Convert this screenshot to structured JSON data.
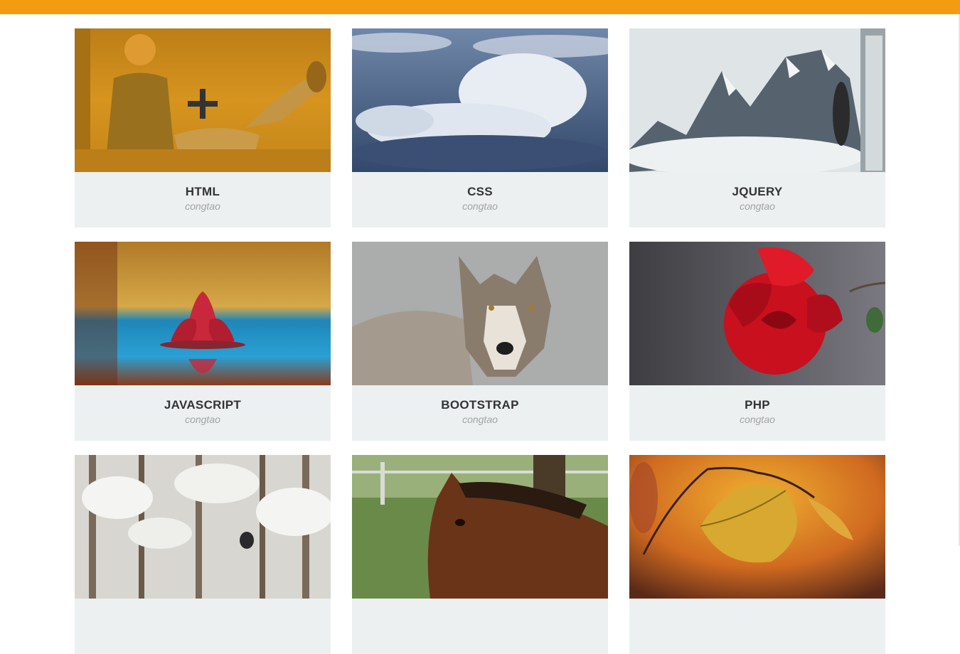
{
  "header": {
    "accent_color": "#f39c12"
  },
  "portfolio": {
    "hover_icon": "plus-icon",
    "items": [
      {
        "title": "HTML",
        "author": "congtao",
        "image": "couple-in-grass-photo",
        "hovered": true
      },
      {
        "title": "CSS",
        "author": "congtao",
        "image": "clouds-photo",
        "hovered": false
      },
      {
        "title": "JQUERY",
        "author": "congtao",
        "image": "mountains-photo",
        "hovered": false
      },
      {
        "title": "JAVASCRIPT",
        "author": "congtao",
        "image": "water-lily-photo",
        "hovered": false
      },
      {
        "title": "BOOTSTRAP",
        "author": "congtao",
        "image": "wolf-photo",
        "hovered": false
      },
      {
        "title": "PHP",
        "author": "congtao",
        "image": "red-rose-photo",
        "hovered": false
      },
      {
        "title": "",
        "author": "",
        "image": "snowy-forest-wolf-photo",
        "hovered": false
      },
      {
        "title": "",
        "author": "",
        "image": "horse-photo",
        "hovered": false
      },
      {
        "title": "",
        "author": "",
        "image": "autumn-leaf-photo",
        "hovered": false
      }
    ]
  },
  "colors": {
    "caption_bg": "#ecf0f1",
    "title": "#333333",
    "author": "#a3a3a3"
  }
}
